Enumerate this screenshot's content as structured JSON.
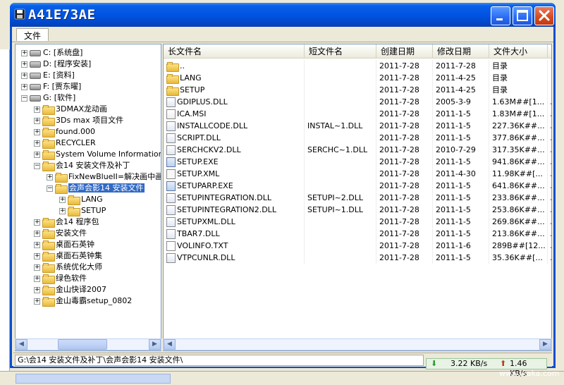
{
  "window": {
    "title": "A41E73AE"
  },
  "menu": {
    "file": "文件"
  },
  "tree": [
    {
      "label": "C: [系统盘]",
      "type": "drive",
      "level": 0,
      "expander": "+"
    },
    {
      "label": "D: [程序安装]",
      "type": "drive",
      "level": 0,
      "expander": "+"
    },
    {
      "label": "E: [资料]",
      "type": "drive",
      "level": 0,
      "expander": "+"
    },
    {
      "label": "F: [贾东曜]",
      "type": "drive",
      "level": 0,
      "expander": "+"
    },
    {
      "label": "G: [软件]",
      "type": "drive",
      "level": 0,
      "expander": "-"
    },
    {
      "label": "3DMAX龙动画",
      "type": "folder",
      "level": 1,
      "expander": "+"
    },
    {
      "label": "3Ds max 项目文件",
      "type": "folder",
      "level": 1,
      "expander": "+"
    },
    {
      "label": "found.000",
      "type": "folder",
      "level": 1,
      "expander": "+"
    },
    {
      "label": "RECYCLER",
      "type": "folder",
      "level": 1,
      "expander": "+"
    },
    {
      "label": "System Volume Information",
      "type": "folder",
      "level": 1,
      "expander": "+"
    },
    {
      "label": "会14 安装文件及补丁",
      "type": "folder",
      "level": 1,
      "expander": "-"
    },
    {
      "label": "FixNewBlueII=解决画中画",
      "type": "folder",
      "level": 2,
      "expander": "+"
    },
    {
      "label": "会声会影14 安装文件",
      "type": "folder",
      "level": 2,
      "expander": "-",
      "selected": true
    },
    {
      "label": "LANG",
      "type": "folder",
      "level": 3,
      "expander": "+"
    },
    {
      "label": "SETUP",
      "type": "folder",
      "level": 3,
      "expander": "+"
    },
    {
      "label": "会14 程序包",
      "type": "folder",
      "level": 1,
      "expander": "+"
    },
    {
      "label": "安装文件",
      "type": "folder",
      "level": 1,
      "expander": "+"
    },
    {
      "label": "桌面石英钟",
      "type": "folder",
      "level": 1,
      "expander": "+"
    },
    {
      "label": "桌面石英钟集",
      "type": "folder",
      "level": 1,
      "expander": "+"
    },
    {
      "label": "系统优化大师",
      "type": "folder",
      "level": 1,
      "expander": "+"
    },
    {
      "label": "绿色软件",
      "type": "folder",
      "level": 1,
      "expander": "+"
    },
    {
      "label": "金山快译2007",
      "type": "folder",
      "level": 1,
      "expander": "+"
    },
    {
      "label": "金山毒霸setup_0802",
      "type": "folder",
      "level": 1,
      "expander": "+"
    }
  ],
  "list": {
    "columns": [
      "长文件名",
      "短文件名",
      "创建日期",
      "修改日期",
      "文件大小",
      "文"
    ],
    "rows": [
      {
        "icon": "folder",
        "long": "..",
        "short": "",
        "created": "2011-7-28",
        "modified": "2011-7-28",
        "size": "目录",
        "attr": ""
      },
      {
        "icon": "folder",
        "long": "LANG",
        "short": "",
        "created": "2011-7-28",
        "modified": "2011-4-25",
        "size": "目录",
        "attr": ""
      },
      {
        "icon": "folder",
        "long": "SETUP",
        "short": "",
        "created": "2011-7-28",
        "modified": "2011-4-25",
        "size": "目录",
        "attr": ""
      },
      {
        "icon": "dll",
        "long": "GDIPLUS.DLL",
        "short": "",
        "created": "2011-7-28",
        "modified": "2005-3-9",
        "size": "1.63M##[1...",
        "attr": "A"
      },
      {
        "icon": "msi",
        "long": "ICA.MSI",
        "short": "",
        "created": "2011-7-28",
        "modified": "2011-1-5",
        "size": "1.83M##[1...",
        "attr": "A"
      },
      {
        "icon": "dll",
        "long": "INSTALLCODE.DLL",
        "short": "INSTAL~1.DLL",
        "created": "2011-7-28",
        "modified": "2011-1-5",
        "size": "227.36K##...",
        "attr": "A"
      },
      {
        "icon": "dll",
        "long": "SCRIPT.DLL",
        "short": "",
        "created": "2011-7-28",
        "modified": "2011-1-5",
        "size": "377.86K##...",
        "attr": "A"
      },
      {
        "icon": "dll",
        "long": "SERCHCKV2.DLL",
        "short": "SERCHC~1.DLL",
        "created": "2011-7-28",
        "modified": "2010-7-29",
        "size": "317.35K##...",
        "attr": "A"
      },
      {
        "icon": "exe",
        "long": "SETUP.EXE",
        "short": "",
        "created": "2011-7-28",
        "modified": "2011-1-5",
        "size": "941.86K##...",
        "attr": "A"
      },
      {
        "icon": "xml",
        "long": "SETUP.XML",
        "short": "",
        "created": "2011-7-28",
        "modified": "2011-4-30",
        "size": "11.98K##[...",
        "attr": "A"
      },
      {
        "icon": "exe",
        "long": "SETUPARP.EXE",
        "short": "",
        "created": "2011-7-28",
        "modified": "2011-1-5",
        "size": "641.86K##...",
        "attr": "A"
      },
      {
        "icon": "dll",
        "long": "SETUPINTEGRATION.DLL",
        "short": "SETUPI~2.DLL",
        "created": "2011-7-28",
        "modified": "2011-1-5",
        "size": "233.86K##...",
        "attr": "A"
      },
      {
        "icon": "dll",
        "long": "SETUPINTEGRATION2.DLL",
        "short": "SETUPI~1.DLL",
        "created": "2011-7-28",
        "modified": "2011-1-5",
        "size": "253.86K##...",
        "attr": "A"
      },
      {
        "icon": "dll",
        "long": "SETUPXML.DLL",
        "short": "",
        "created": "2011-7-28",
        "modified": "2011-1-5",
        "size": "269.86K##...",
        "attr": "A"
      },
      {
        "icon": "dll",
        "long": "TBAR7.DLL",
        "short": "",
        "created": "2011-7-28",
        "modified": "2011-1-5",
        "size": "213.86K##...",
        "attr": "A"
      },
      {
        "icon": "txt",
        "long": "VOLINFO.TXT",
        "short": "",
        "created": "2011-7-28",
        "modified": "2011-1-6",
        "size": "289B##[12...",
        "attr": "A"
      },
      {
        "icon": "dll",
        "long": "VTPCUNLR.DLL",
        "short": "",
        "created": "2011-7-28",
        "modified": "2011-1-5",
        "size": "35.36K##[...",
        "attr": "A"
      }
    ]
  },
  "status": {
    "path": "G:\\会14 安装文件及补丁\\会声会影14 安装文件\\"
  },
  "netspeed": {
    "down": "3.22 KB/s",
    "up": "1.46 KB/s"
  },
  "watermark": {
    "url": "www.ikaka.com"
  }
}
